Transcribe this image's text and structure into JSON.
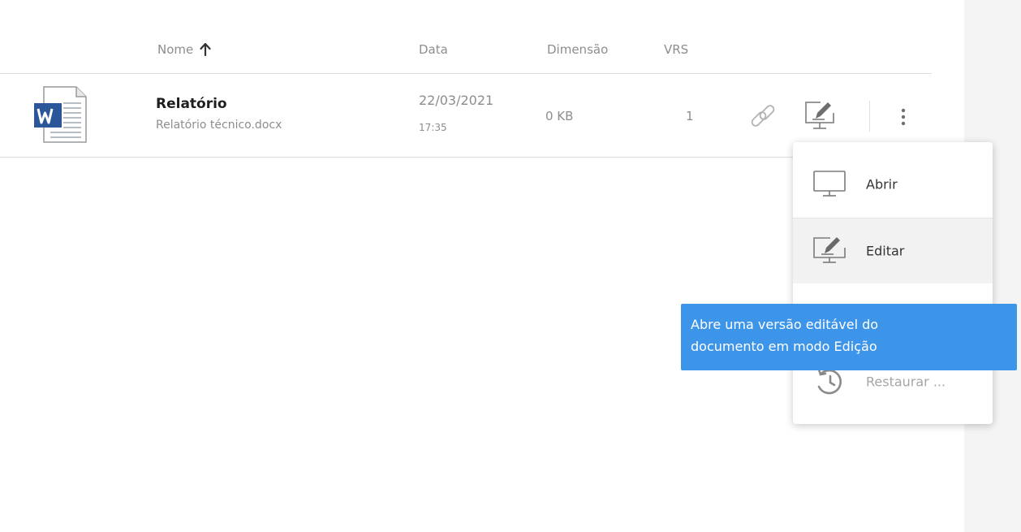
{
  "table": {
    "headers": {
      "name": "Nome",
      "date": "Data",
      "size": "Dimensão",
      "vrs": "VRS"
    },
    "sort": {
      "column": "name",
      "direction": "ascending",
      "icon": "arrow-up-icon"
    },
    "rows": [
      {
        "icon": "word-document-icon",
        "title": "Relatório",
        "filename": "Relatório técnico.docx",
        "date": "22/03/2021",
        "time": "17:35",
        "size": "0 KB",
        "vrs": "1",
        "actions": [
          "link-icon",
          "edit-document-icon",
          "more-vertical-icon"
        ]
      }
    ]
  },
  "menu": {
    "items": [
      {
        "label": "Abrir",
        "icon": "monitor-icon"
      },
      {
        "label": "Editar",
        "icon": "monitor-edit-icon",
        "state": "hovered"
      },
      {
        "label": "Restaurar ...",
        "icon": "history-restore-icon",
        "state": "disabled"
      }
    ]
  },
  "tooltip": {
    "line1": "Abre uma versão editável do",
    "line2": "documento em modo Edição"
  },
  "colors": {
    "tooltip_bg": "#3d95ea",
    "word_blue": "#2b579a",
    "muted_text": "#8d8d8d",
    "side_panel": "#f4f4f4"
  }
}
